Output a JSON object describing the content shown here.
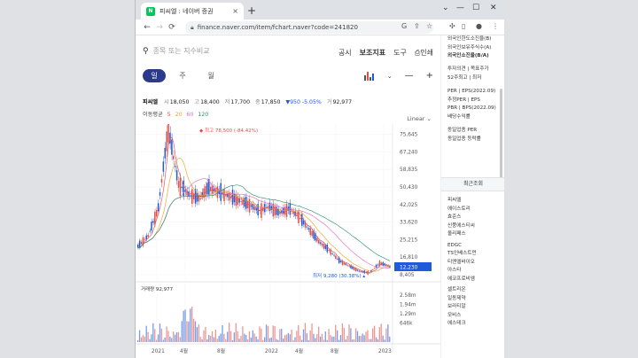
{
  "browser": {
    "tab_title": "피씨엘 : 네이버 증권",
    "favicon_text": "N",
    "tab_close": "×",
    "new_tab": "+",
    "url": "finance.naver.com/item/fchart.naver?code=241820"
  },
  "page": {
    "search_placeholder": "종목 또는 지수비교",
    "menu": [
      "공시",
      "보조지표",
      "도구",
      "인쇄"
    ],
    "periods": [
      "일",
      "주",
      "월"
    ],
    "active_period": "일",
    "scale_mode": "Linear"
  },
  "quote": {
    "name": "피씨엘",
    "open_label": "시",
    "open": "18,050",
    "high_label": "고",
    "high": "18,400",
    "low_label": "저",
    "low": "17,700",
    "close_label": "종",
    "close": "17,850",
    "change": "▼950 -5.05%",
    "volume_label": "거",
    "volume": "92,977"
  },
  "moving_average": {
    "label": "이동평균",
    "periods": [
      "5",
      "20",
      "60",
      "120"
    ],
    "colors": [
      "#e0504a",
      "#f0a020",
      "#e06cc0",
      "#2b8c6a"
    ]
  },
  "chart_data": {
    "type": "line",
    "y_ticks": [
      "75,645",
      "67,240",
      "58,835",
      "50,430",
      "42,025",
      "33,620",
      "25,215",
      "16,810",
      "8,405"
    ],
    "x_ticks": [
      "2021",
      "4월",
      "8월",
      "2022",
      "4월",
      "8월",
      "2023"
    ],
    "current_price": "12,230",
    "max_label": "최고 78,500 (-84.42%)",
    "min_label": "최저 9,280 (30.38%)",
    "volume_label": "거래량",
    "volume_value": "92,977",
    "volume_ticks": [
      "2.58m",
      "1.94m",
      "1.29m",
      "646k"
    ],
    "price_series": [
      {
        "x": "2021-01",
        "y": 22000
      },
      {
        "x": "2021-02",
        "y": 27000
      },
      {
        "x": "2021-03",
        "y": 40000
      },
      {
        "x": "2021-03",
        "y": 78500
      },
      {
        "x": "2021-04",
        "y": 52000
      },
      {
        "x": "2021-05",
        "y": 47000
      },
      {
        "x": "2021-06",
        "y": 45000
      },
      {
        "x": "2021-07",
        "y": 50000
      },
      {
        "x": "2021-08",
        "y": 48000
      },
      {
        "x": "2021-09",
        "y": 46000
      },
      {
        "x": "2021-10",
        "y": 44000
      },
      {
        "x": "2021-11",
        "y": 42000
      },
      {
        "x": "2021-12",
        "y": 39000
      },
      {
        "x": "2022-01",
        "y": 41000
      },
      {
        "x": "2022-02",
        "y": 38000
      },
      {
        "x": "2022-03",
        "y": 40000
      },
      {
        "x": "2022-04",
        "y": 36000
      },
      {
        "x": "2022-05",
        "y": 30000
      },
      {
        "x": "2022-06",
        "y": 24000
      },
      {
        "x": "2022-07",
        "y": 20000
      },
      {
        "x": "2022-08",
        "y": 15000
      },
      {
        "x": "2022-09",
        "y": 12500
      },
      {
        "x": "2022-10",
        "y": 10000
      },
      {
        "x": "2022-11",
        "y": 9280
      },
      {
        "x": "2022-12",
        "y": 14000
      },
      {
        "x": "2023-01",
        "y": 12230
      }
    ],
    "colors": {
      "up": "#e0504a",
      "down": "#1f5bd8",
      "current_tag": "#1f5bd8"
    }
  },
  "sidebar": {
    "top_items": [
      "외국인한도소진율(B)",
      "외국인보유주식수(A)",
      "외국인소진율(B/A)"
    ],
    "rating_items": [
      "투자의견 | 목표주가",
      "52주최고 | 최저"
    ],
    "per_items": [
      "PER | EPS(2022.09)",
      "추정PER | EPS",
      "PBR | BPS(2022.09)",
      "배당수익률"
    ],
    "sector_items": [
      "동일업종 PER",
      "동일업종 등락률"
    ],
    "recent_label": "최근조회",
    "recent_items": [
      "피씨엘",
      "에이스토리",
      "효준스",
      "신풍에스티씨",
      "올리패스",
      "EDGC",
      "TS인베스트먼",
      "티엔엘바이오",
      "아스타",
      "에코프로비엠",
      "셀트리온",
      "일동제약",
      "보라티알",
      "모비스",
      "에스테크"
    ]
  }
}
